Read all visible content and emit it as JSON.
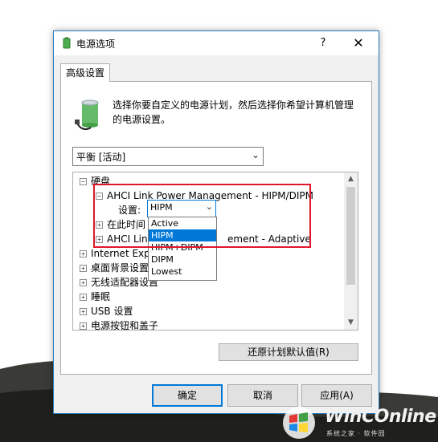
{
  "dialog": {
    "title": "电源选项",
    "help_glyph": "?",
    "close_glyph": "✕"
  },
  "tab": {
    "label": "高级设置"
  },
  "description": "选择你要自定义的电源计划，然后选择你希望计算机管理的电源设置。",
  "plan_select": {
    "value": "平衡 [活动]"
  },
  "tree": {
    "items": [
      {
        "label": "硬盘",
        "toggle": "−"
      },
      {
        "label": "AHCI Link Power Management - HIPM/DIPM",
        "toggle": "−"
      },
      {
        "label": "设置:"
      },
      {
        "label": "在此时间",
        "toggle": "+"
      },
      {
        "label": "AHCI Lin",
        "label_tail": "ement - Adaptive",
        "toggle": "+"
      },
      {
        "label": "Internet Explo",
        "toggle": "+"
      },
      {
        "label": "桌面背景设置",
        "toggle": "+"
      },
      {
        "label": "无线适配器设置",
        "toggle": "+"
      },
      {
        "label": "睡眠",
        "toggle": "+"
      },
      {
        "label": "USB 设置",
        "toggle": "+"
      },
      {
        "label": "电源按钮和盖子",
        "toggle": "+"
      }
    ]
  },
  "setting_combo": {
    "value": "HIPM"
  },
  "dropdown": {
    "options": [
      "Active",
      "HIPM",
      "HIPM+DIPM",
      "DIPM",
      "Lowest"
    ],
    "selected_index": 1
  },
  "buttons": {
    "restore": "还原计划默认值(R)",
    "ok": "确定",
    "cancel": "取消",
    "apply": "应用(A)"
  },
  "watermark": {
    "text": "WinCOnline",
    "sub": "系统之家 · 软件园"
  },
  "colors": {
    "accent": "#0078d7",
    "highlight_box": "#e0162b"
  },
  "icons": [
    "power-options-icon",
    "help-icon",
    "close-icon",
    "battery-icon",
    "chevron-down-icon",
    "scroll-up-icon",
    "scroll-down-icon",
    "windows-logo-icon"
  ]
}
